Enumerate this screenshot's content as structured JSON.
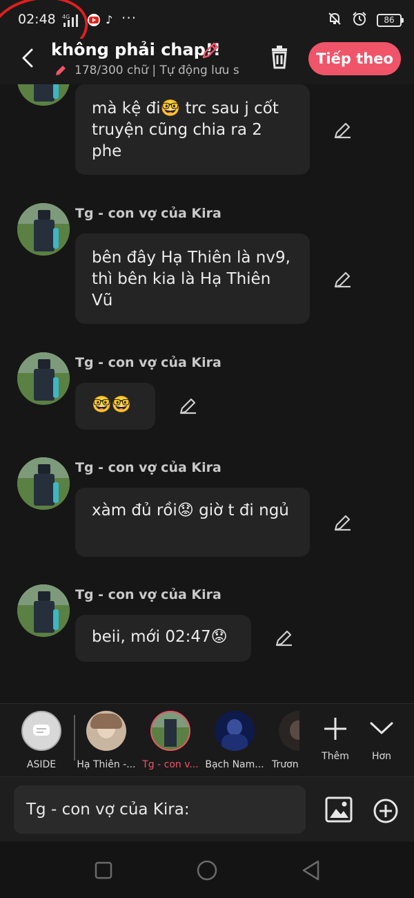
{
  "status_bar": {
    "time": "02:48",
    "network": "4G",
    "battery": "86"
  },
  "header": {
    "chapter_title": "không phải chap!!",
    "subtitle": "178/300 chữ | Tự động lưu s",
    "next_button": "Tiếp theo"
  },
  "messages": [
    {
      "sender": "",
      "text": "mà kệ đi🤓 trc sau j cốt truyện cũng chia ra 2 phe"
    },
    {
      "sender": "Tg - con vợ của Kira",
      "text": "bên đây Hạ Thiên là nv9, thì bên kia là Hạ Thiên Vũ"
    },
    {
      "sender": "Tg - con vợ của Kira",
      "text": "🤓🤓"
    },
    {
      "sender": "Tg - con vợ của Kira",
      "text": "xàm đủ rồi😟 giờ t đi ngủ"
    },
    {
      "sender": "Tg - con vợ của Kira",
      "text": "beii, mới 02:47😟"
    }
  ],
  "characters": [
    {
      "label": "ASIDE",
      "active": false
    },
    {
      "label": "Hạ Thiên -...",
      "active": false
    },
    {
      "label": "Tg - con v...",
      "active": true
    },
    {
      "label": "Bạch Nam...",
      "active": false
    },
    {
      "label": "Trươn",
      "active": false
    }
  ],
  "strip_actions": {
    "add_label": "Thêm",
    "more_label": "Hơn"
  },
  "composer": {
    "placeholder": "Tg - con vợ của Kira:"
  },
  "colors": {
    "accent": "#f05469",
    "bubble": "#242424",
    "background": "#161616"
  }
}
